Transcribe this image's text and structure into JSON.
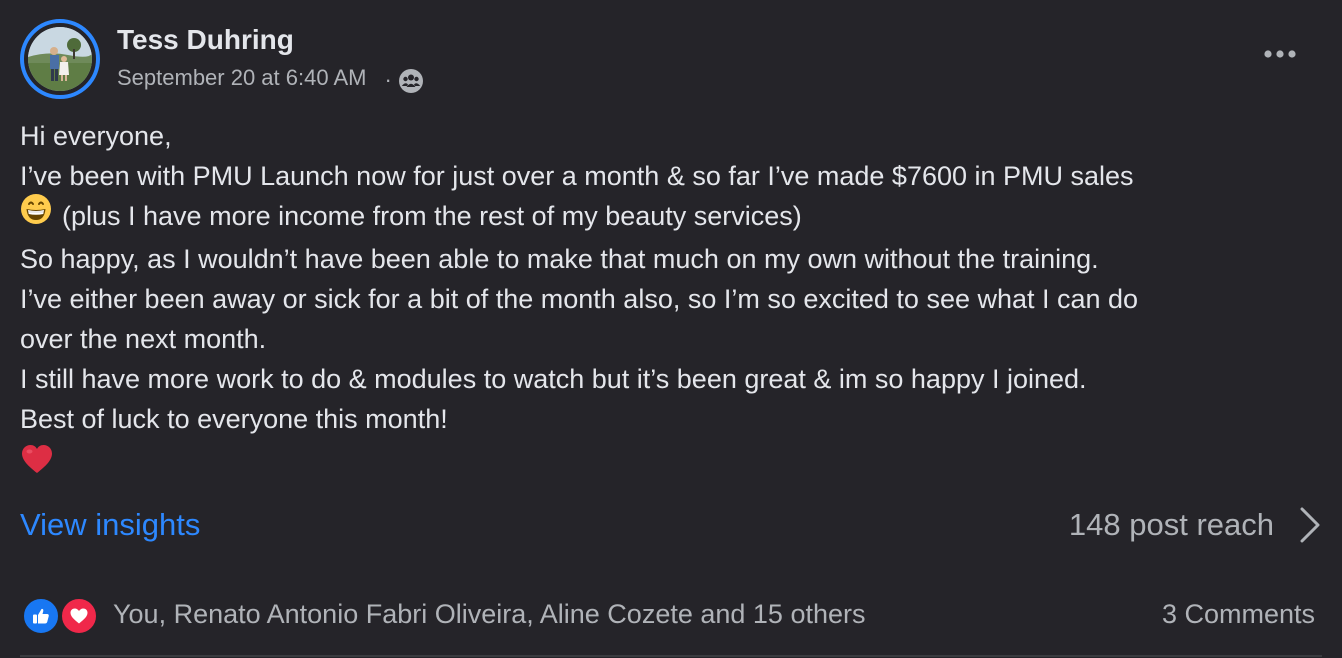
{
  "author": {
    "name": "Tess Duhring",
    "timestamp": "September 20 at 6:40 AM",
    "separator": "·",
    "audience_icon": "members-group-icon",
    "avatar_ring_color": "#2d88ff"
  },
  "menu": {
    "icon": "more-options-icon"
  },
  "post": {
    "lines": [
      "Hi everyone,",
      "I’ve been with PMU Launch now for just over a month & so far I’ve made $7600 in PMU sales",
      "(plus I have more income from the rest of my beauty services)",
      "So happy, as I wouldn’t have been able to make that much on my own without the training.",
      "I’ve either been away or sick for a bit of the month also, so I’m so excited to see what I can do",
      "over the next month.",
      "I still have more work to do & modules to watch but it’s been great & im so happy I joined.",
      "Best of luck to everyone this month!"
    ],
    "inline_emoji": "grinning-face-emoji",
    "closing_emoji": "red-heart-emoji"
  },
  "insights": {
    "link_label": "View insights",
    "reach_label": "148 post reach",
    "link_color": "#2d88ff"
  },
  "reactions": {
    "icons": [
      "like-reaction-icon",
      "love-reaction-icon"
    ],
    "names": "You, Renato Antonio Fabri Oliveira, Aline Cozete and 15 others",
    "comments": "3 Comments"
  },
  "colors": {
    "background": "#252429",
    "primary_text": "#e4e6eb",
    "secondary_text": "#b0b3b8",
    "like_blue": "#1877f2",
    "love_red": "#f0284a"
  }
}
